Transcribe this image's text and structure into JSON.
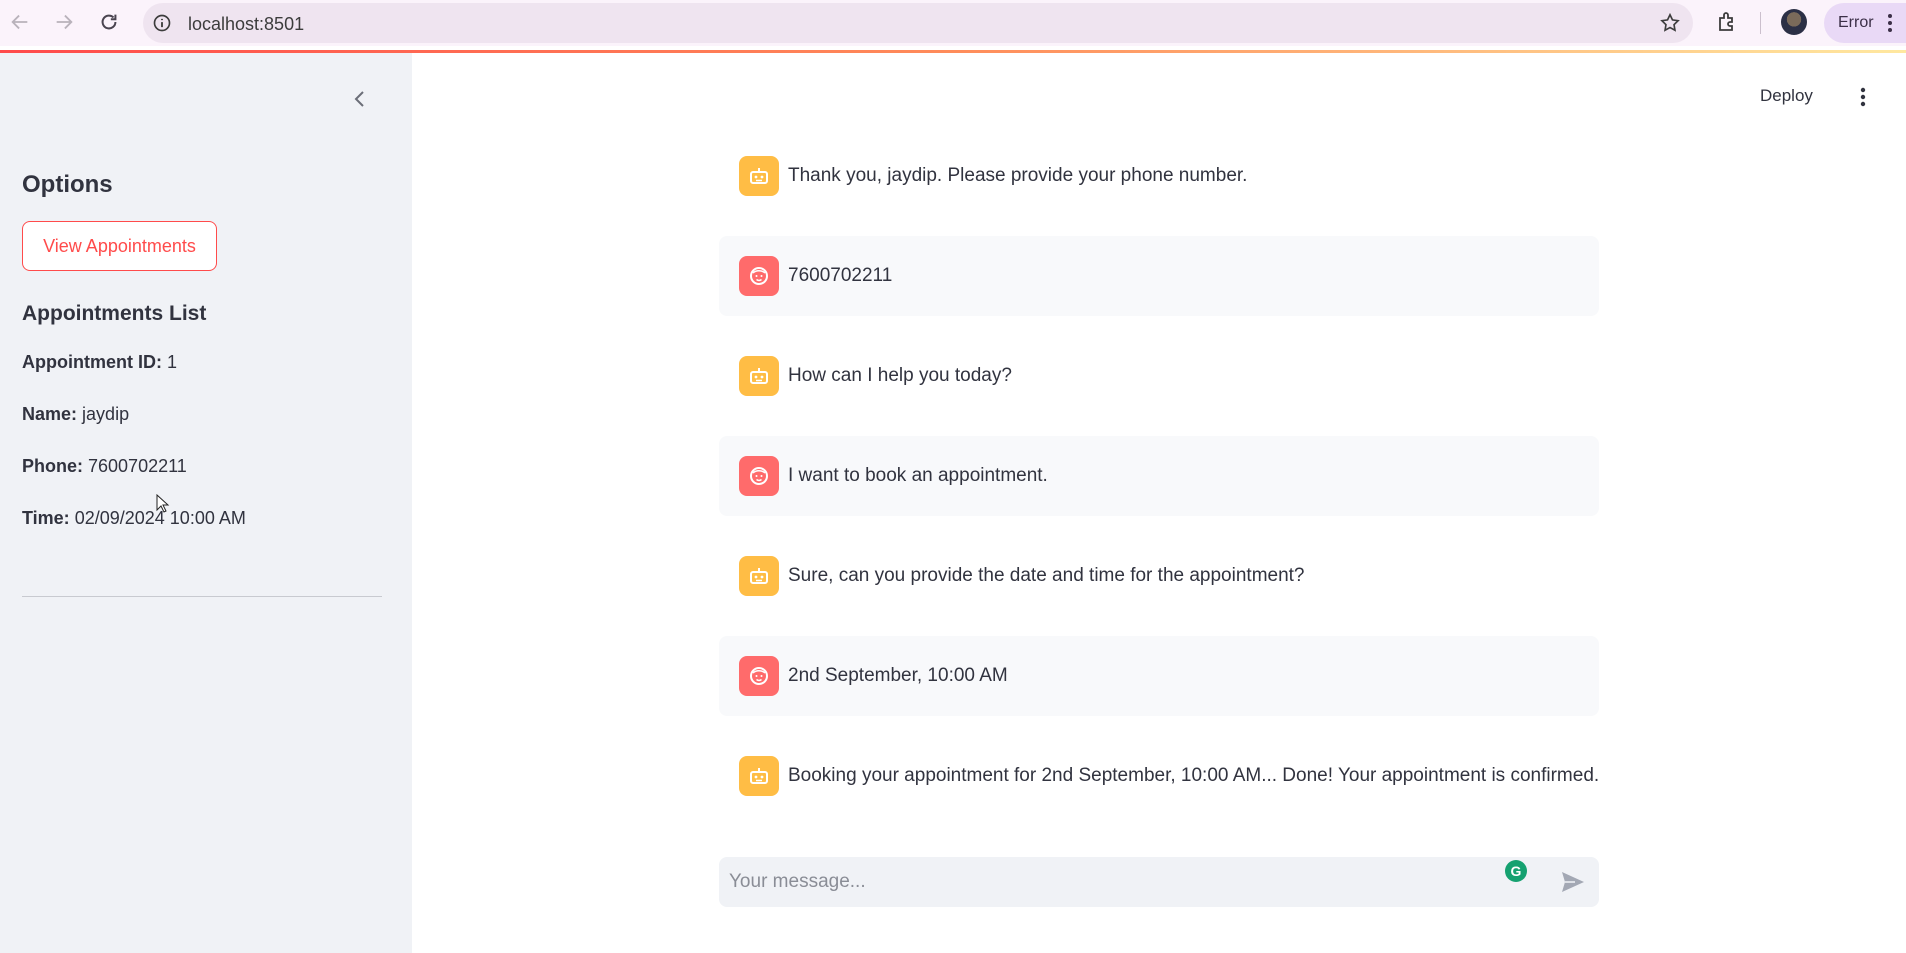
{
  "browser": {
    "url": "localhost:8501",
    "profile_status": "Error"
  },
  "sidebar": {
    "title": "Options",
    "view_button_label": "View Appointments",
    "list_title": "Appointments List",
    "appointment": {
      "id_label": "Appointment ID:",
      "id_value": "1",
      "name_label": "Name:",
      "name_value": "jaydip",
      "phone_label": "Phone:",
      "phone_value": "7600702211",
      "time_label": "Time:",
      "time_value": "02/09/2024 10:00 AM"
    }
  },
  "header": {
    "deploy_label": "Deploy"
  },
  "messages": [
    {
      "role": "assistant",
      "text": "Thank you, jaydip. Please provide your phone number."
    },
    {
      "role": "user",
      "text": "7600702211"
    },
    {
      "role": "assistant",
      "text": "How can I help you today?"
    },
    {
      "role": "user",
      "text": "I want to book an appointment."
    },
    {
      "role": "assistant",
      "text": "Sure, can you provide the date and time for the appointment?"
    },
    {
      "role": "user",
      "text": "2nd September, 10:00 AM"
    },
    {
      "role": "assistant",
      "text": "Booking your appointment for 2nd September, 10:00 AM... Done! Your appointment is confirmed."
    }
  ],
  "chat_input": {
    "placeholder": "Your message..."
  },
  "icons": {
    "assistant_avatar": "robot-icon",
    "user_avatar": "face-icon",
    "send": "send-icon"
  },
  "colors": {
    "accent": "#ff4b4b",
    "assistant_avatar_bg": "#ffbd45",
    "user_avatar_bg": "#ff6b6b",
    "sidebar_bg": "#f0f2f6"
  }
}
